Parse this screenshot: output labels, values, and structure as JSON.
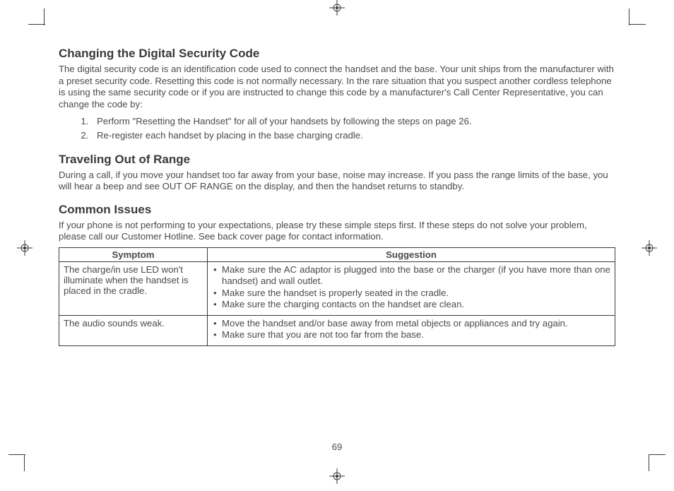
{
  "sections": {
    "security": {
      "heading": "Changing the Digital Security Code",
      "body": "The digital security code is an identification code used to connect the handset and the base. Your unit ships from the manufacturer with a preset security code. Resetting this code is not normally necessary. In the rare situation that you suspect another cordless telephone is using the same security code or if you are instructed to change this code by a manufacturer's Call Center Representative, you can change the code by:",
      "steps": [
        "Perform \"Resetting the Handset\" for all of your handsets by following the steps on page 26.",
        "Re-register each handset by placing in the base charging cradle."
      ]
    },
    "range": {
      "heading": "Traveling Out of Range",
      "body": "During a call, if you move your handset too far away from your base, noise may increase. If you pass the range limits of the base, you will hear a beep and see OUT OF RANGE on the display, and then the handset returns to standby."
    },
    "issues": {
      "heading": "Common Issues",
      "body": "If your phone is not performing to your expectations, please try these simple steps first. If these steps do not solve your problem, please call our Customer Hotline. See back cover page for contact information.",
      "table": {
        "headers": {
          "symptom": "Symptom",
          "suggestion": "Suggestion"
        },
        "rows": [
          {
            "symptom": "The charge/in use LED won't illuminate when the handset is placed in the cradle.",
            "suggestions": [
              "Make sure the AC adaptor is plugged into the base or the charger (if you have more than one handset) and wall outlet.",
              "Make sure the handset is properly seated in the cradle.",
              "Make sure the charging contacts on the handset are clean."
            ]
          },
          {
            "symptom": "The audio sounds weak.",
            "suggestions": [
              "Move the handset and/or base away from metal objects or appliances and try again.",
              "Make sure that you are not too far from the base."
            ]
          }
        ]
      }
    }
  },
  "page_number": "69"
}
